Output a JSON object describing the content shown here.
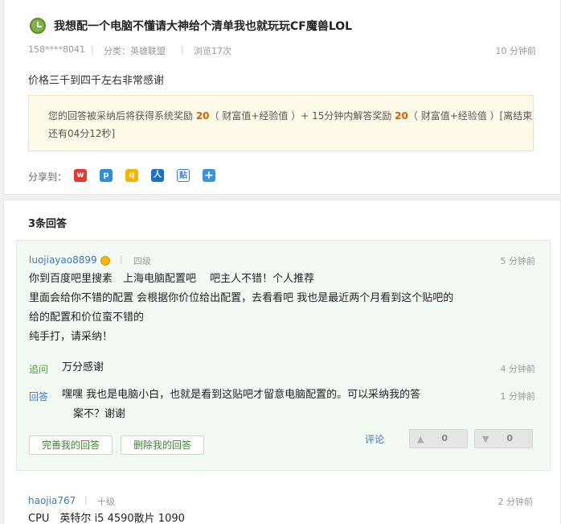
{
  "question": {
    "title": "我想配一个电脑不懂请大神给个清单我也就玩玩CF魔兽LOL",
    "user": "158****8041",
    "category": "分类：英雄联盟",
    "views": "浏览17次",
    "time": "10 分钟前",
    "body": "价格三千到四千左右非常感谢"
  },
  "reward": {
    "line1_pre": "您的回答被采纳后将获得系统奖励 ",
    "points1": "20",
    "line1_mid": "（ 财富值+经验值 ）+ 15分钟内解答奖励 ",
    "points2": "20",
    "line1_post": "（ 财富值+经验值 ）[离结束",
    "line2": "还有04分12秒]"
  },
  "share": {
    "label": "分享到：",
    "icons": [
      "weibo-icon",
      "qzone-icon",
      "qq-icon",
      "renren-icon",
      "tieba-icon",
      "more-icon"
    ]
  },
  "answers": {
    "count_title": "3条回答",
    "first": {
      "user": "luojiayao8899",
      "level": "四级",
      "time": "5 分钟前",
      "lines": [
        "你到百度吧里搜素　上海电脑配置吧　 吧主人不错！个人推荐",
        "里面会给你不错的配置 会根据你价位给出配置，去看看吧 我也是最近两个月看到这个贴吧的",
        "给的配置和价位蛮不错的",
        "纯手打，请采纳！"
      ],
      "followup": {
        "label": "追问",
        "text": "万分感谢",
        "time": "4 分钟前"
      },
      "reply": {
        "label": "回答",
        "line1": "嘿嘿 我也是电脑小白，也就是看到这贴吧才留意电脑配置的。可以采纳我的答",
        "line2": "案不？谢谢",
        "time": "1 分钟前"
      },
      "buttons": {
        "improve": "完善我的回答",
        "delete": "删除我的回答",
        "comment": "评论",
        "up_count": "0",
        "down_count": "0"
      }
    },
    "second": {
      "user": "haojia767",
      "level": "十级",
      "time": "2 分钟前",
      "line1": "CPU　英特尔 i5 4590散片 1090"
    }
  },
  "colors": {
    "link": "#3e79b9",
    "accent_orange": "#e06000",
    "answer_bg": "#f3faf3",
    "reward_bg": "#fffbe8"
  }
}
